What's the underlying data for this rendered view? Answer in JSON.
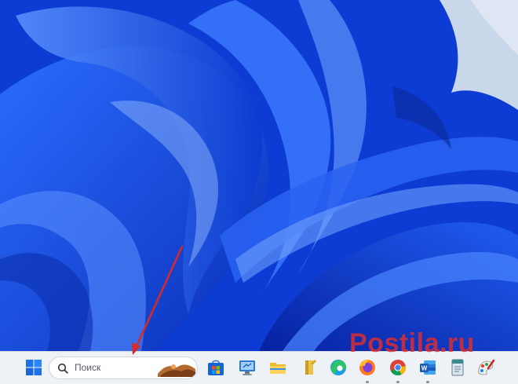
{
  "desktop": {
    "wallpaper": "windows-11-bloom-blue",
    "colors": {
      "base": "#0a3fd6",
      "light": "#4f8cff",
      "dark": "#0626a3",
      "sky": "#c8d7ea"
    }
  },
  "annotation": {
    "arrow_color": "#d42a2a",
    "points_to": "search-box"
  },
  "taskbar": {
    "start_icon": "windows-start-icon",
    "search": {
      "placeholder": "Поиск",
      "icon": "search-icon",
      "highlight_icon": "search-highlight-art-icon"
    },
    "apps": [
      {
        "name": "microsoft-store-icon",
        "running": false
      },
      {
        "name": "remote-desktop-icon",
        "running": false
      },
      {
        "name": "file-explorer-icon",
        "running": false
      },
      {
        "name": "notepad-app-icon",
        "running": false
      },
      {
        "name": "edge-icon",
        "running": false
      },
      {
        "name": "firefox-icon",
        "running": true
      },
      {
        "name": "chrome-icon",
        "running": true
      },
      {
        "name": "word-icon",
        "running": true
      },
      {
        "name": "notes-app-icon",
        "running": false
      },
      {
        "name": "paint-icon",
        "running": false
      }
    ]
  },
  "watermark": {
    "text": "Postila.ru",
    "color": "#e12d2d"
  }
}
